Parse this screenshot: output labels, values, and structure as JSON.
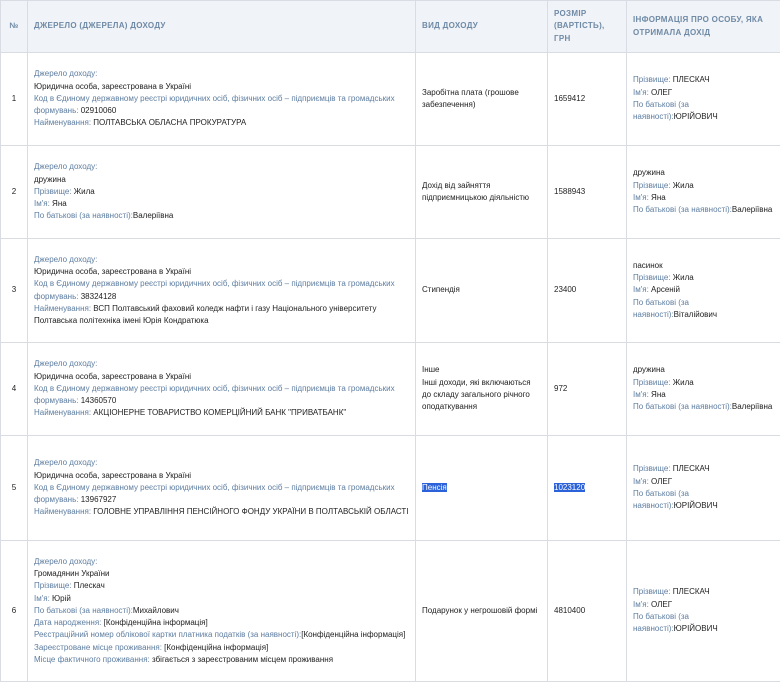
{
  "headers": {
    "num": "№",
    "source": "ДЖЕРЕЛО (ДЖЕРЕЛА) ДОХОДУ",
    "type": "ВИД ДОХОДУ",
    "amount": "РОЗМІР (ВАРТІСТЬ), ГРН",
    "person": "ІНФОРМАЦІЯ ПРО ОСОБУ, ЯКА ОТРИМАЛА ДОХІД"
  },
  "rows": [
    {
      "num": "1",
      "source": [
        {
          "label": "Джерело доходу:",
          "value": ""
        },
        {
          "label": "",
          "value": "Юридична особа, зареєстрована в Україні"
        },
        {
          "label": "Код в Єдиному державному реєстрі юридичних осіб, фізичних осіб – підприємців та громадських формувань:",
          "value": " 02910060"
        },
        {
          "label": "Найменування:",
          "value": " ПОЛТАВСЬКА ОБЛАСНА ПРОКУРАТУРА"
        }
      ],
      "type": [
        "Заробітна плата (грошове забезпечення)"
      ],
      "amount": "1659412",
      "person": [
        {
          "label": "Прізвище:",
          "value": " ПЛЕСКАЧ"
        },
        {
          "label": "Ім'я:",
          "value": " ОЛЕГ"
        },
        {
          "label": "По батькові (за наявності):",
          "value": "ЮРІЙОВИЧ"
        }
      ]
    },
    {
      "num": "2",
      "source": [
        {
          "label": "Джерело доходу:",
          "value": ""
        },
        {
          "label": "",
          "value": "дружина"
        },
        {
          "label": "Прізвище:",
          "value": " Жила"
        },
        {
          "label": "Ім'я:",
          "value": " Яна"
        },
        {
          "label": "По батькові (за наявності):",
          "value": "Валеріївна"
        }
      ],
      "type": [
        "Дохід від зайняття підприємницькою діяльністю"
      ],
      "amount": "1588943",
      "person": [
        {
          "label": "",
          "value": "дружина"
        },
        {
          "label": "Прізвище:",
          "value": " Жила"
        },
        {
          "label": "Ім'я:",
          "value": " Яна"
        },
        {
          "label": "По батькові (за наявності):",
          "value": "Валеріївна"
        }
      ]
    },
    {
      "num": "3",
      "source": [
        {
          "label": "Джерело доходу:",
          "value": ""
        },
        {
          "label": "",
          "value": "Юридична особа, зареєстрована в Україні"
        },
        {
          "label": "Код в Єдиному державному реєстрі юридичних осіб, фізичних осіб – підприємців та громадських формувань:",
          "value": " 38324128"
        },
        {
          "label": "Найменування:",
          "value": " ВСП Полтавський фаховий коледж нафти і газу Національного університету Полтавська політехніка імені Юрія Кондратюка"
        }
      ],
      "type": [
        "Стипендія"
      ],
      "amount": "23400",
      "person": [
        {
          "label": "",
          "value": "пасинок"
        },
        {
          "label": "Прізвище:",
          "value": " Жила"
        },
        {
          "label": "Ім'я:",
          "value": " Арсеній"
        },
        {
          "label": "По батькові (за наявності):",
          "value": "Віталійович"
        }
      ]
    },
    {
      "num": "4",
      "source": [
        {
          "label": "Джерело доходу:",
          "value": ""
        },
        {
          "label": "",
          "value": "Юридична особа, зареєстрована в Україні"
        },
        {
          "label": "Код в Єдиному державному реєстрі юридичних осіб, фізичних осіб – підприємців та громадських формувань:",
          "value": " 14360570"
        },
        {
          "label": "Найменування:",
          "value": " АКЦІОНЕРНЕ ТОВАРИСТВО КОМЕРЦІЙНИЙ БАНК \"ПРИВАТБАНК\""
        }
      ],
      "type": [
        "Інше",
        "Інші доходи, які включаються до складу загального річного оподаткування"
      ],
      "amount": "972",
      "person": [
        {
          "label": "",
          "value": "дружина"
        },
        {
          "label": "Прізвище:",
          "value": " Жила"
        },
        {
          "label": "Ім'я:",
          "value": " Яна"
        },
        {
          "label": "По батькові (за наявності):",
          "value": "Валеріївна"
        }
      ]
    },
    {
      "num": "5",
      "source": [
        {
          "label": "Джерело доходу:",
          "value": ""
        },
        {
          "label": "",
          "value": "Юридична особа, зареєстрована в Україні"
        },
        {
          "label": "Код в Єдиному державному реєстрі юридичних осіб, фізичних осіб – підприємців та громадських формувань:",
          "value": " 13967927"
        },
        {
          "label": "Найменування:",
          "value": " ГОЛОВНЕ УПРАВЛІННЯ ПЕНСІЙНОГО ФОНДУ УКРАЇНИ В ПОЛТАВСЬКІЙ ОБЛАСТІ"
        }
      ],
      "type": [
        "Пенсія"
      ],
      "amount": "1023120",
      "highlight": true,
      "person": [
        {
          "label": "Прізвище:",
          "value": " ПЛЕСКАЧ"
        },
        {
          "label": "Ім'я:",
          "value": " ОЛЕГ"
        },
        {
          "label": "По батькові (за наявності):",
          "value": "ЮРІЙОВИЧ"
        }
      ]
    },
    {
      "num": "6",
      "source": [
        {
          "label": "Джерело доходу:",
          "value": ""
        },
        {
          "label": "",
          "value": "Громадянин України"
        },
        {
          "label": "Прізвище:",
          "value": " Плескач"
        },
        {
          "label": "Ім'я:",
          "value": " Юрій"
        },
        {
          "label": "По батькові (за наявності):",
          "value": "Михайлович"
        },
        {
          "label": "Дата народження:",
          "value": " [Конфіденційна інформація]"
        },
        {
          "label": "Реєстраційний номер облікової картки платника податків (за наявності):",
          "value": "[Конфіденційна інформація]"
        },
        {
          "label": "Зареєстроване місце проживання:",
          "value": " [Конфіденційна інформація]"
        },
        {
          "label": "Місце фактичного проживання:",
          "value": " збігається з зареєстрованим місцем проживання"
        }
      ],
      "type": [
        "Подарунок у негрошовій формі"
      ],
      "amount": "4810400",
      "person": [
        {
          "label": "Прізвище:",
          "value": " ПЛЕСКАЧ"
        },
        {
          "label": "Ім'я:",
          "value": " ОЛЕГ"
        },
        {
          "label": "По батькові (за наявності):",
          "value": "ЮРІЙОВИЧ"
        }
      ]
    }
  ]
}
